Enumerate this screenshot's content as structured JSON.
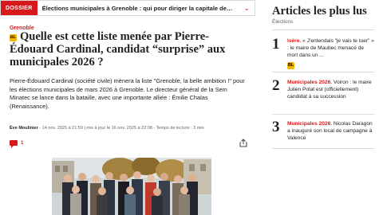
{
  "dossier": {
    "tag": "DOSSIER",
    "text": "Élections municipales à Grenoble : qui pour diriger la capitale des ...",
    "chevron": "⌄"
  },
  "article": {
    "category": "Grenoble",
    "premium_badge": "BL",
    "title": "Quelle est cette liste menée par Pierre-Édouard Cardinal, candidat “surprise” aux municipales 2026 ?",
    "chapo": "Pierre-Édouard Cardinal (société civile) mènera la liste \"Grenoble, la belle ambition !\" pour les élections municipales de mars 2026 à Grenoble. Le directeur général de la Sem Minatec se lance dans la bataille, avec une importante alliée : Émilie Chalas (Renaissance).",
    "author": "Ève Moulinier",
    "byline_rest": " - 14 nov. 2025 à 21:59 | mis à jour le 16 nov. 2025 à 22:08 - Temps de lecture : 3 min",
    "comment_count": "1",
    "icons": {
      "comments": "comment-icon",
      "share": "share-icon"
    }
  },
  "aside": {
    "title": "Articles les plus lus",
    "subtitle": "Élections",
    "items": [
      {
        "num": "1",
        "keyword": "Isère.",
        "text": " « J’entendais “je vais te tuer” » : le maire de Maubec menacé de mort dans un ..."
      },
      {
        "num": "2",
        "keyword": "Municipales 2026.",
        "text": " Voiron : le maire Julien Polat est (officiellement) candidat à sa succession"
      },
      {
        "num": "3",
        "keyword": "Municipales 2026.",
        "text": " Nicolas Daragon a inauguré son local de campagne à Valence"
      }
    ]
  },
  "colors": {
    "accent": "#d7191b",
    "premium": "#f2b500"
  }
}
